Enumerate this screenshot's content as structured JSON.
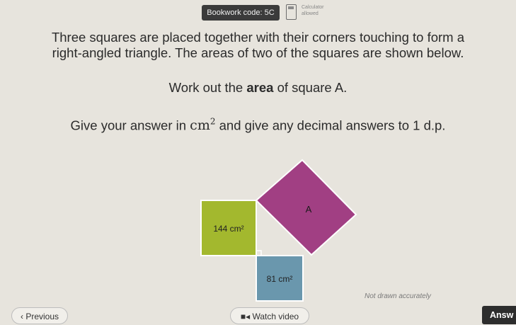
{
  "header": {
    "bookwork_code": "Bookwork code: 5C",
    "calculator_note": "Calculator allowed"
  },
  "question": {
    "line1": "Three squares are placed together with their corners touching to form a",
    "line2": "right-angled triangle. The areas of two of the squares are shown below.",
    "instruction_pre": "Work out the ",
    "instruction_bold": "area",
    "instruction_post": " of square A.",
    "answer_pre": "Give your answer in ",
    "answer_unit": "cm",
    "answer_unit_power": "2",
    "answer_post": " and give any decimal answers to 1 d.p."
  },
  "diagram": {
    "green_square_area": "144 cm²",
    "blue_square_area": "81 cm²",
    "purple_square_label": "A",
    "note": "Not drawn accurately",
    "colors": {
      "green": "#a3b82e",
      "blue": "#6a97ad",
      "purple": "#a13f83",
      "outline": "#ffffff"
    }
  },
  "footer": {
    "previous_label": "Previous",
    "watch_video_label": "Watch video",
    "answer_label": "Answ"
  }
}
